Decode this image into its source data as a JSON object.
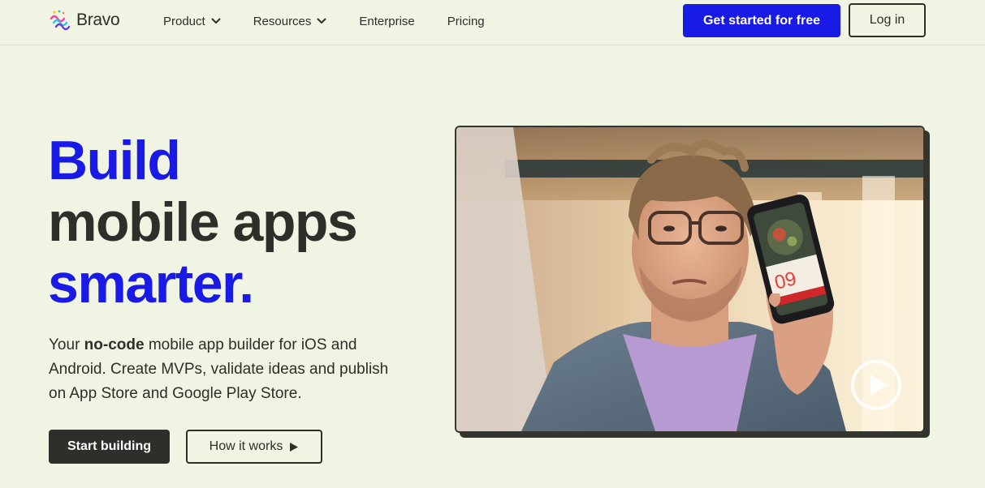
{
  "brand": {
    "name": "Bravo"
  },
  "nav": {
    "items": [
      {
        "label": "Product",
        "has_dropdown": true
      },
      {
        "label": "Resources",
        "has_dropdown": true
      },
      {
        "label": "Enterprise",
        "has_dropdown": false
      },
      {
        "label": "Pricing",
        "has_dropdown": false
      }
    ],
    "cta_label": "Get started for free",
    "login_label": "Log in"
  },
  "hero": {
    "headline_line1": "Build",
    "headline_line2": "mobile apps",
    "headline_line3": "smarter.",
    "sub_prefix": "Your ",
    "sub_bold": "no-code",
    "sub_rest": " mobile app builder for iOS and Android. Create MVPs, validate ideas and publish on App Store and Google Play Store.",
    "start_label": "Start building",
    "how_label": "How it works",
    "video_phone_number": "09"
  },
  "colors": {
    "accent": "#1a1ae6",
    "background": "#f0f4e3",
    "text": "#2e2e2a"
  },
  "icons": {
    "logo": "bravo-logo-icon",
    "dropdown": "chevron-down-icon",
    "play_small": "play-icon",
    "video_play": "play-circle-icon"
  }
}
